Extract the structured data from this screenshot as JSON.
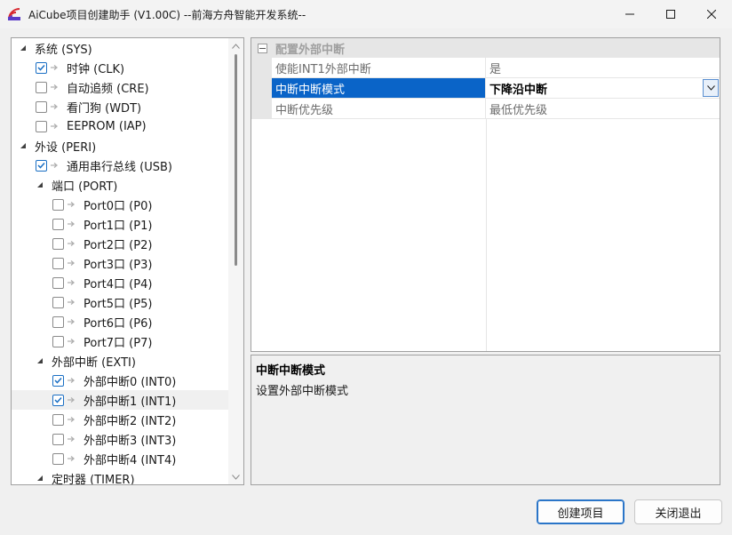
{
  "window": {
    "title": "AiCube项目创建助手 (V1.00C) --前海方舟智能开发系统--",
    "app_icon": "aicube-logo-icon",
    "controls": [
      "minimize-icon",
      "maximize-icon",
      "close-icon"
    ]
  },
  "tree": {
    "items": [
      {
        "label": "系统 (SYS)",
        "level": 0,
        "expanded": true,
        "has_checkbox": false
      },
      {
        "label": "时钟 (CLK)",
        "level": 1,
        "has_checkbox": true,
        "checked": true
      },
      {
        "label": "自动追频 (CRE)",
        "level": 1,
        "has_checkbox": true,
        "checked": false
      },
      {
        "label": "看门狗 (WDT)",
        "level": 1,
        "has_checkbox": true,
        "checked": false
      },
      {
        "label": "EEPROM (IAP)",
        "level": 1,
        "has_checkbox": true,
        "checked": false
      },
      {
        "label": "外设 (PERI)",
        "level": 0,
        "expanded": true,
        "has_checkbox": false
      },
      {
        "label": "通用串行总线 (USB)",
        "level": 1,
        "has_checkbox": true,
        "checked": true
      },
      {
        "label": "端口 (PORT)",
        "level": 1,
        "expanded": true,
        "has_checkbox": false
      },
      {
        "label": "Port0口 (P0)",
        "level": 2,
        "has_checkbox": true,
        "checked": false
      },
      {
        "label": "Port1口 (P1)",
        "level": 2,
        "has_checkbox": true,
        "checked": false
      },
      {
        "label": "Port2口 (P2)",
        "level": 2,
        "has_checkbox": true,
        "checked": false
      },
      {
        "label": "Port3口 (P3)",
        "level": 2,
        "has_checkbox": true,
        "checked": false
      },
      {
        "label": "Port4口 (P4)",
        "level": 2,
        "has_checkbox": true,
        "checked": false
      },
      {
        "label": "Port5口 (P5)",
        "level": 2,
        "has_checkbox": true,
        "checked": false
      },
      {
        "label": "Port6口 (P6)",
        "level": 2,
        "has_checkbox": true,
        "checked": false
      },
      {
        "label": "Port7口 (P7)",
        "level": 2,
        "has_checkbox": true,
        "checked": false
      },
      {
        "label": "外部中断 (EXTI)",
        "level": 1,
        "expanded": true,
        "has_checkbox": false
      },
      {
        "label": "外部中断0 (INT0)",
        "level": 2,
        "has_checkbox": true,
        "checked": true
      },
      {
        "label": "外部中断1 (INT1)",
        "level": 2,
        "has_checkbox": true,
        "checked": true,
        "selected": true
      },
      {
        "label": "外部中断2 (INT2)",
        "level": 2,
        "has_checkbox": true,
        "checked": false
      },
      {
        "label": "外部中断3 (INT3)",
        "level": 2,
        "has_checkbox": true,
        "checked": false
      },
      {
        "label": "外部中断4 (INT4)",
        "level": 2,
        "has_checkbox": true,
        "checked": false
      },
      {
        "label": "定时器 (TIMER)",
        "level": 1,
        "expanded": true,
        "has_checkbox": false
      }
    ]
  },
  "property_grid": {
    "category": "配置外部中断",
    "rows": [
      {
        "name": "使能INT1外部中断",
        "value": "是"
      },
      {
        "name": "中断中断模式",
        "value": "下降沿中断",
        "active": true
      },
      {
        "name": "中断优先级",
        "value": "最低优先级"
      }
    ]
  },
  "description": {
    "title": "中断中断模式",
    "text": "设置外部中断模式"
  },
  "buttons": {
    "create": "创建项目",
    "exit": "关闭退出"
  },
  "colors": {
    "selection": "#0a64c8",
    "checkbox": "#1a6fc4",
    "background": "#f0f0f0"
  }
}
